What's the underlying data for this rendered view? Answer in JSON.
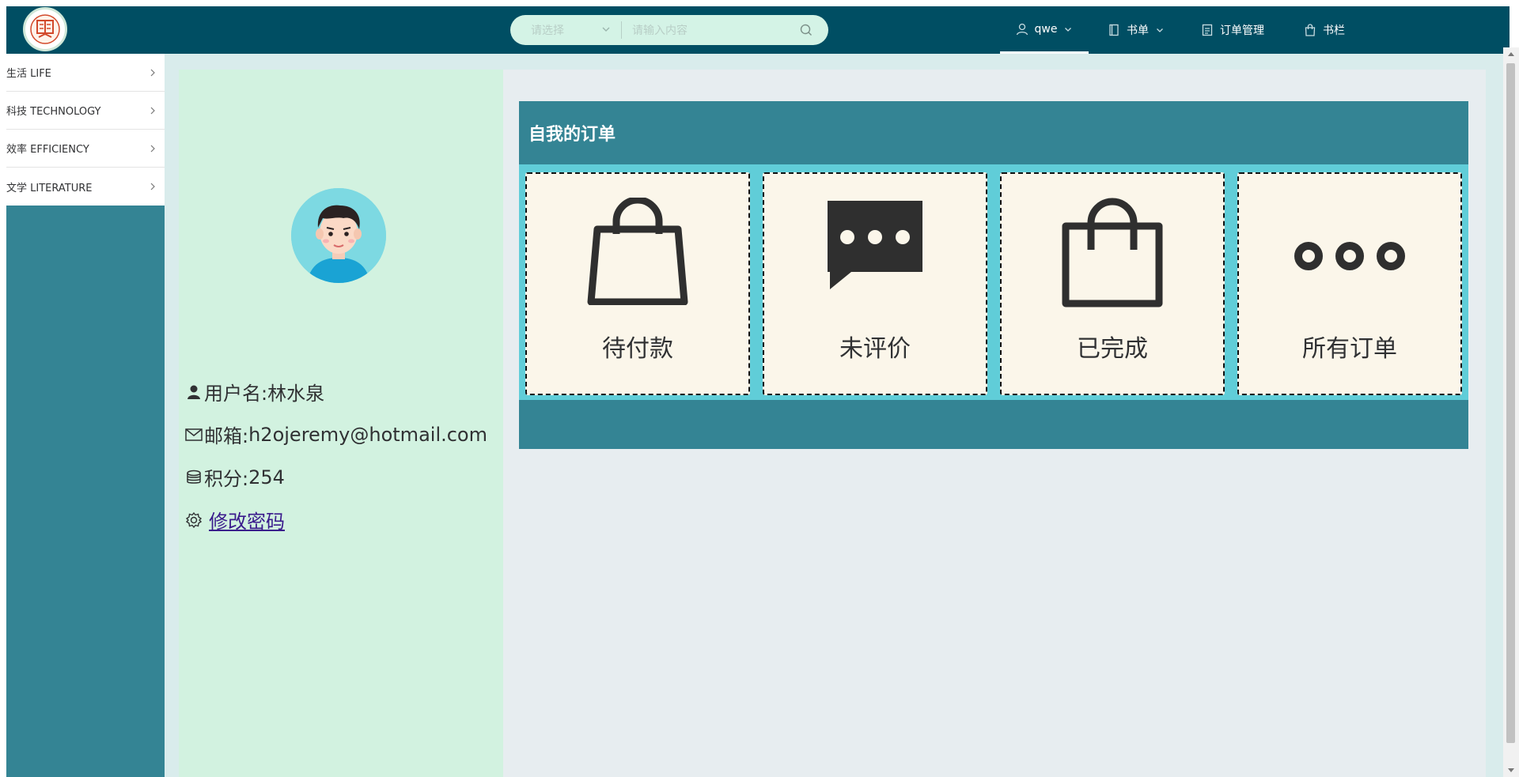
{
  "header": {
    "search": {
      "select_placeholder": "请选择",
      "input_placeholder": "请输入内容"
    },
    "nav": {
      "user": "qwe",
      "booklist": "书单",
      "order_management": "订单管理",
      "bookshelf": "书栏"
    }
  },
  "sidebar": {
    "items": [
      {
        "label": "生活 LIFE"
      },
      {
        "label": "科技 TECHNOLOGY"
      },
      {
        "label": "效率 EFFICIENCY"
      },
      {
        "label": "文学 LITERATURE"
      }
    ]
  },
  "profile": {
    "username_label": "用户名:",
    "username": "林水泉",
    "email_label": "邮箱:",
    "email": "h2ojeremy@hotmail.com",
    "points_label": "积分:",
    "points": "254",
    "change_password": "修改密码"
  },
  "orders": {
    "title": "自我的订单",
    "cards": [
      {
        "label": "待付款",
        "icon": "shopping-bag-icon"
      },
      {
        "label": "未评价",
        "icon": "chat-bubble-icon"
      },
      {
        "label": "已完成",
        "icon": "bag-icon"
      },
      {
        "label": "所有订单",
        "icon": "more-dots-icon"
      }
    ]
  },
  "colors": {
    "topbar": "#004e63",
    "sidebar": "#348494",
    "profile_bg": "#d2f2e0",
    "orders_bg": "#348494",
    "card_strip": "#60cdd8",
    "card_bg": "#fbf6ea"
  }
}
